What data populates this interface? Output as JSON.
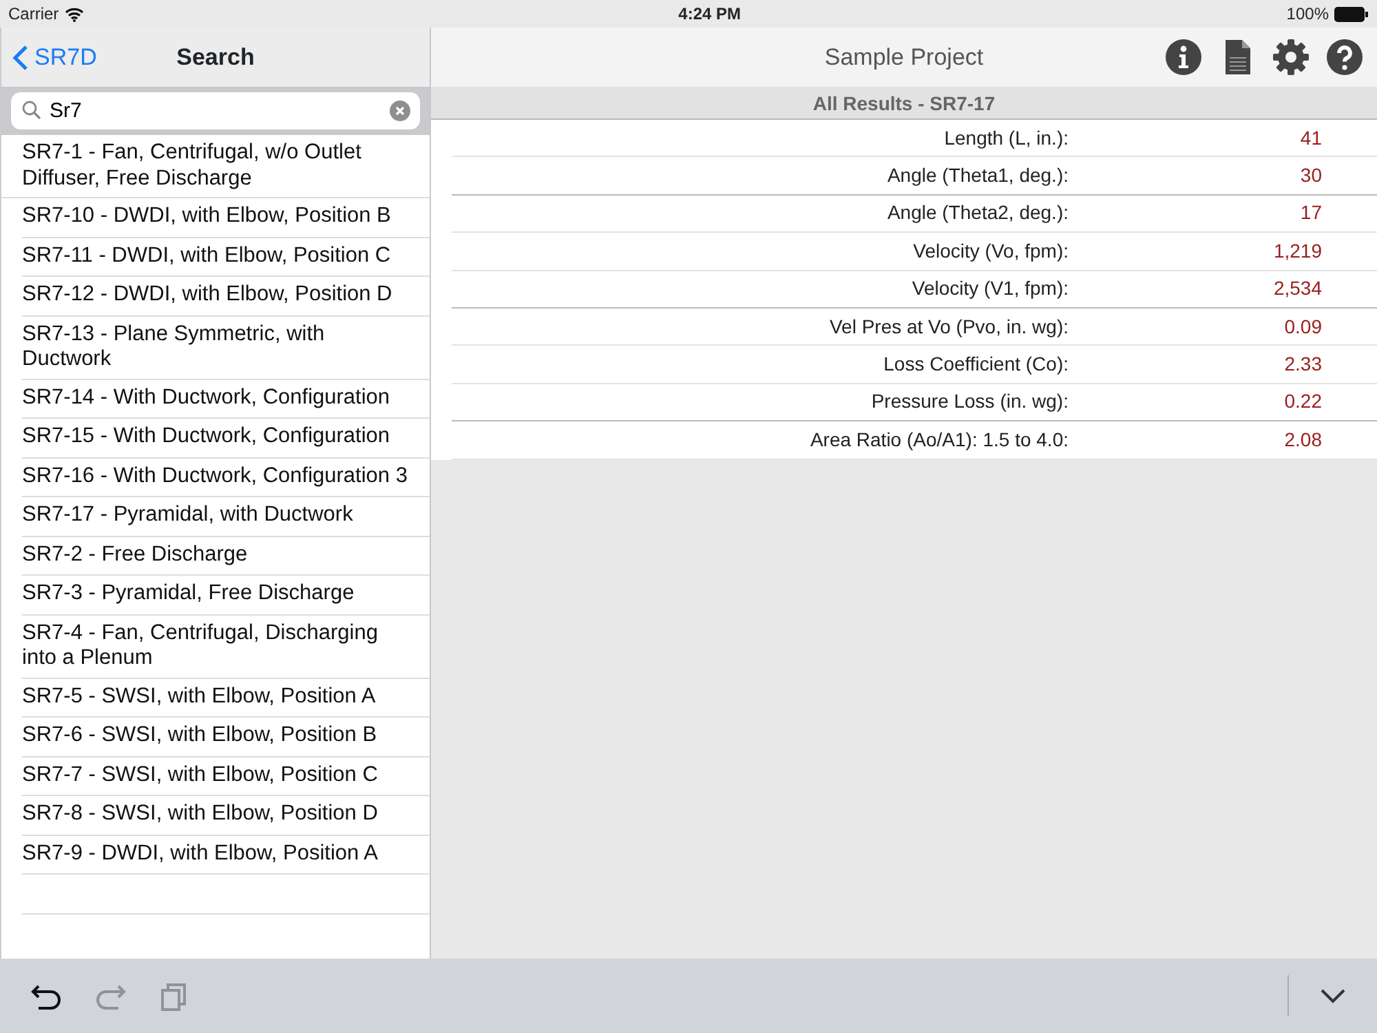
{
  "status_bar": {
    "carrier": "Carrier",
    "time": "4:24 PM",
    "battery": "100%"
  },
  "sidebar": {
    "back_label": "SR7D",
    "title": "Search",
    "search": {
      "value": "Sr7"
    },
    "items": [
      {
        "label": "SR7-1 - Fan, Centrifugal, w/o Outlet Diffuser, Free Discharge"
      },
      {
        "label": "SR7-10 - DWDI, with Elbow, Position B"
      },
      {
        "label": "SR7-11 - DWDI, with Elbow, Position C"
      },
      {
        "label": "SR7-12 - DWDI, with Elbow, Position D"
      },
      {
        "label": "SR7-13 - Plane Symmetric, with Ductwork"
      },
      {
        "label": "SR7-14 - With Ductwork, Configuration"
      },
      {
        "label": "SR7-15 - With Ductwork, Configuration"
      },
      {
        "label": "SR7-16 - With Ductwork, Configuration 3"
      },
      {
        "label": "SR7-17 - Pyramidal, with Ductwork"
      },
      {
        "label": "SR7-2 - Free Discharge"
      },
      {
        "label": "SR7-3 - Pyramidal, Free Discharge"
      },
      {
        "label": "SR7-4 - Fan, Centrifugal, Discharging into a Plenum"
      },
      {
        "label": "SR7-5 - SWSI, with Elbow, Position A"
      },
      {
        "label": "SR7-6 - SWSI, with Elbow, Position B"
      },
      {
        "label": "SR7-7 - SWSI, with Elbow, Position C"
      },
      {
        "label": "SR7-8 - SWSI, with Elbow, Position D"
      },
      {
        "label": "SR7-9 - DWDI, with Elbow, Position A"
      }
    ]
  },
  "main": {
    "title": "Sample Project",
    "results_title": "All Results - SR7-17",
    "results": [
      {
        "label": "Length (L, in.):",
        "value": "41",
        "section_break": false
      },
      {
        "label": "Angle (Theta1, deg.):",
        "value": "30",
        "section_break": true
      },
      {
        "label": "Angle (Theta2, deg.):",
        "value": "17",
        "section_break": false
      },
      {
        "label": "Velocity (Vo, fpm):",
        "value": "1,219",
        "section_break": false
      },
      {
        "label": "Velocity (V1, fpm):",
        "value": "2,534",
        "section_break": true
      },
      {
        "label": "Vel Pres at Vo (Pvo, in. wg):",
        "value": "0.09",
        "section_break": false
      },
      {
        "label": "Loss Coefficient (Co):",
        "value": "2.33",
        "section_break": false
      },
      {
        "label": "Pressure Loss (in. wg):",
        "value": "0.22",
        "section_break": true
      },
      {
        "label": "Area Ratio (Ao/A1): 1.5 to 4.0:",
        "value": "2.08",
        "section_break": false
      }
    ]
  },
  "toolbar": {
    "undo": {
      "disabled": false
    },
    "redo": {
      "disabled": true
    },
    "copy": {
      "disabled": true
    }
  }
}
